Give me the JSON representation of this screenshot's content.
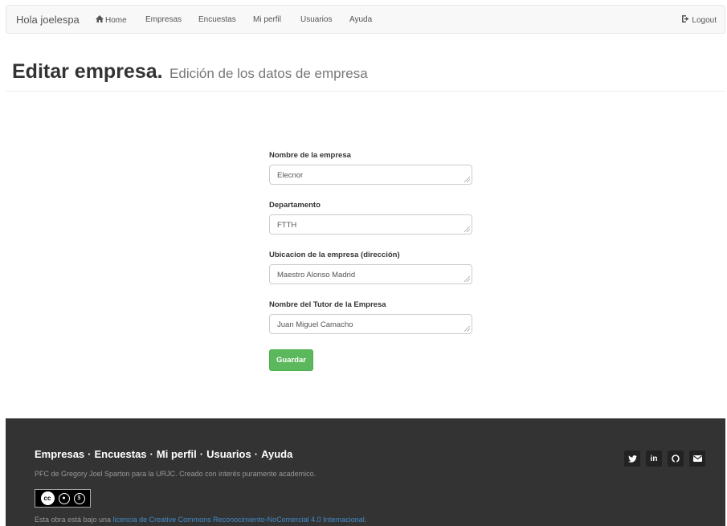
{
  "navbar": {
    "brand": "Hola joelespa",
    "items": [
      {
        "label": "Home",
        "icon": "home-icon"
      },
      {
        "label": "Empresas"
      },
      {
        "label": "Encuestas"
      },
      {
        "label": "Mi perfil"
      },
      {
        "label": "Usuarios"
      },
      {
        "label": "Ayuda"
      }
    ],
    "logout": "Logout"
  },
  "header": {
    "title": "Editar empresa.",
    "subtitle": "Edición de los datos de empresa"
  },
  "form": {
    "fields": [
      {
        "label": "Nombre de la empresa",
        "value": "Elecnor"
      },
      {
        "label": "Departamento",
        "value": "FTTH"
      },
      {
        "label": "Ubicacion de la empresa (dirección)",
        "value": "Maestro Alonso Madrid"
      },
      {
        "label": "Nombre del Tutor de la Empresa",
        "value": "Juan Miguel Camacho"
      }
    ],
    "save_label": "Guardar"
  },
  "footer": {
    "links": [
      "Empresas",
      "Encuestas",
      "Mi perfil",
      "Usuarios",
      "Ayuda"
    ],
    "separator": "·",
    "copy": "PFC de Gregory Joel Sparton para la URJC. Creado con interés puramente academico.",
    "license_prefix": "Esta obra está bajo una ",
    "license_link": "licencia de Creative Commons Reconocimiento-NoComercial 4.0 Internacional",
    "license_suffix": ".",
    "social": [
      "twitter-icon",
      "linkedin-icon",
      "github-icon",
      "email-icon"
    ]
  },
  "colors": {
    "navbar_bg": "#f8f8f8",
    "footer_bg": "#333333",
    "save_button": "#5cb85c",
    "link": "#428bca"
  }
}
